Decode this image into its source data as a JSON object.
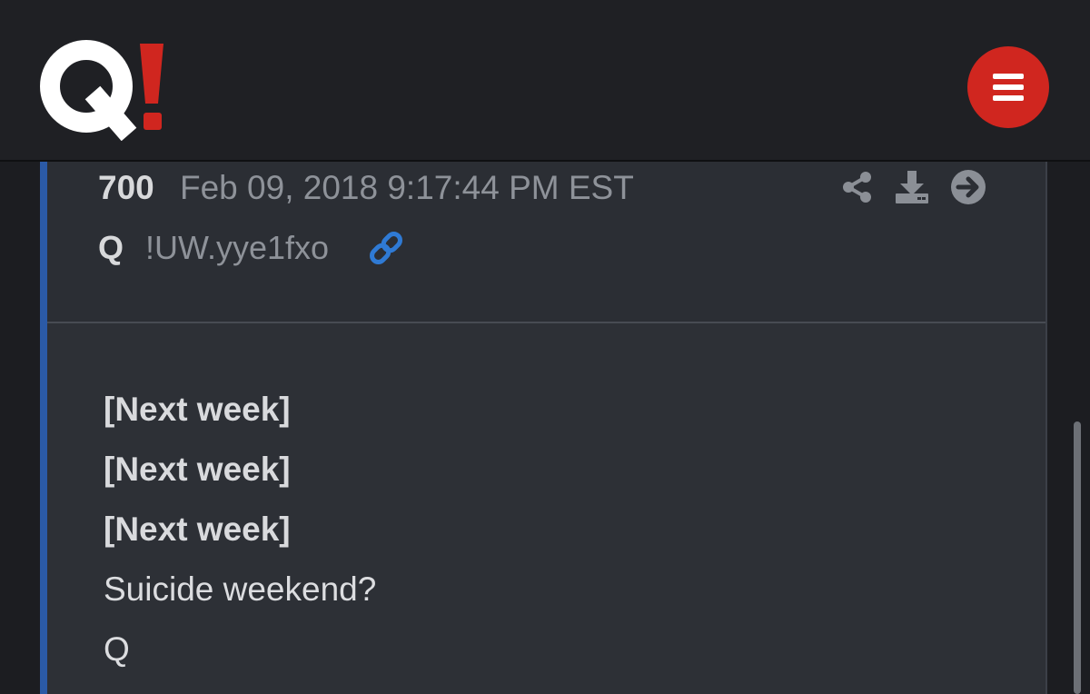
{
  "header": {
    "logo_text": "Q!",
    "menu_icon": "hamburger-icon",
    "brand_colors": {
      "logo_white": "#ffffff",
      "logo_red": "#d0261f",
      "menu_bg": "#d0261f"
    }
  },
  "post": {
    "number": "700",
    "date": "Feb 09, 2018 9:17:44 PM EST",
    "author": "Q",
    "tripcode": "!UW.yye1fxo",
    "icons": [
      "share-icon",
      "download-icon",
      "arrow-right-circle-icon",
      "link-icon"
    ],
    "accent_color": "#2b5aa6",
    "link_color": "#2f7ad4",
    "body_lines": [
      {
        "text": "[Next week]",
        "bold": true
      },
      {
        "text": "[Next week]",
        "bold": true
      },
      {
        "text": "[Next week]",
        "bold": true
      },
      {
        "text": "Suicide weekend?",
        "bold": false
      },
      {
        "text": "Q",
        "bold": false
      }
    ]
  }
}
